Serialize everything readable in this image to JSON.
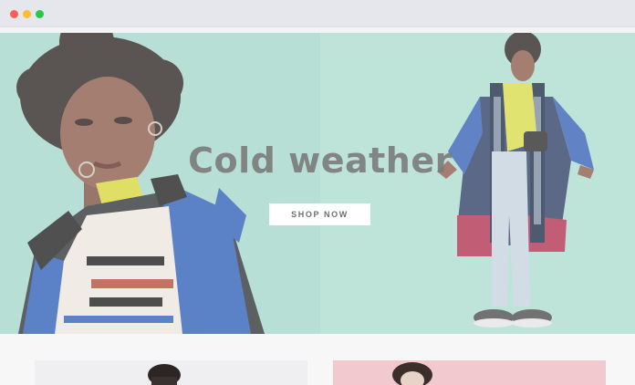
{
  "window": {
    "controls": [
      "close",
      "minimize",
      "zoom"
    ],
    "colors": {
      "close": "#fb5f57",
      "minimize": "#febc2e",
      "zoom": "#28c840"
    }
  },
  "hero": {
    "title": "Cold weather",
    "cta_label": "SHOP NOW",
    "background_color": "#a9dbcf",
    "left_image": "portrait-model-puffer-jacket",
    "right_image": "full-length-model-scarf-coat"
  },
  "cards": [
    {
      "image": "model-on-light-grey",
      "background_color": "#efeff2"
    },
    {
      "image": "model-on-pink",
      "background_color": "#f2c9cf"
    }
  ]
}
